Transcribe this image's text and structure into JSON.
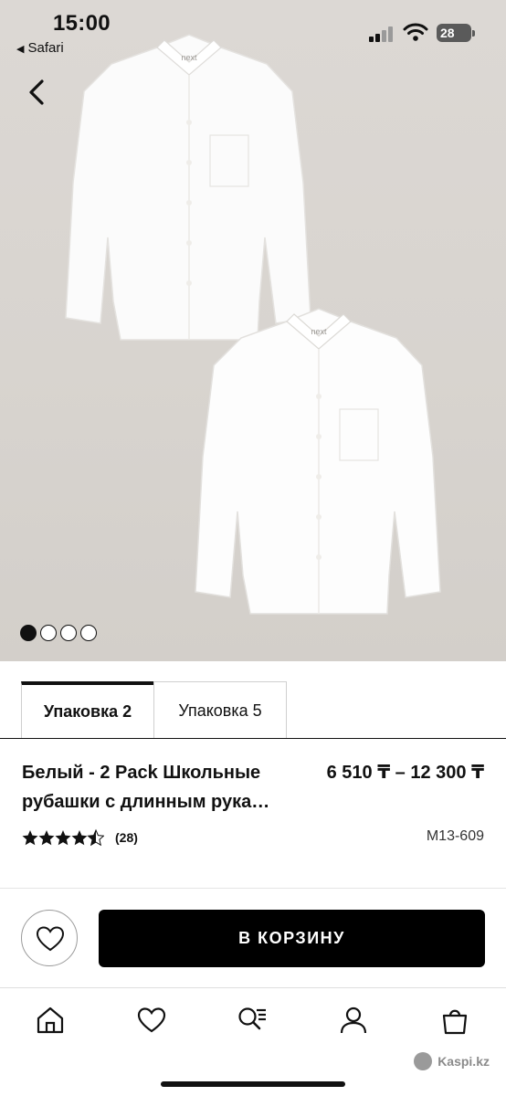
{
  "status_bar": {
    "time": "15:00",
    "back_app": "Safari",
    "battery": "28"
  },
  "gallery": {
    "brand_label_1": "next",
    "brand_label_2": "next",
    "dots_total": 4,
    "dots_active": 1
  },
  "tabs": [
    {
      "label": "Упаковка 2",
      "active": true
    },
    {
      "label": "Упаковка 5",
      "active": false
    }
  ],
  "product": {
    "title": "Белый - 2 Pack Школьные рубашки с длинным рука…",
    "price": "6 510 ₸ – 12 300 ₸",
    "rating_value": 4.5,
    "reviews": "(28)",
    "sku": "M13-609"
  },
  "actions": {
    "add_to_cart": "В КОРЗИНУ"
  },
  "bottom_nav": {
    "items": [
      "home-icon",
      "heart-icon",
      "catalog-search-icon",
      "profile-icon",
      "bag-icon"
    ]
  },
  "watermark": "Kaspi.kz"
}
